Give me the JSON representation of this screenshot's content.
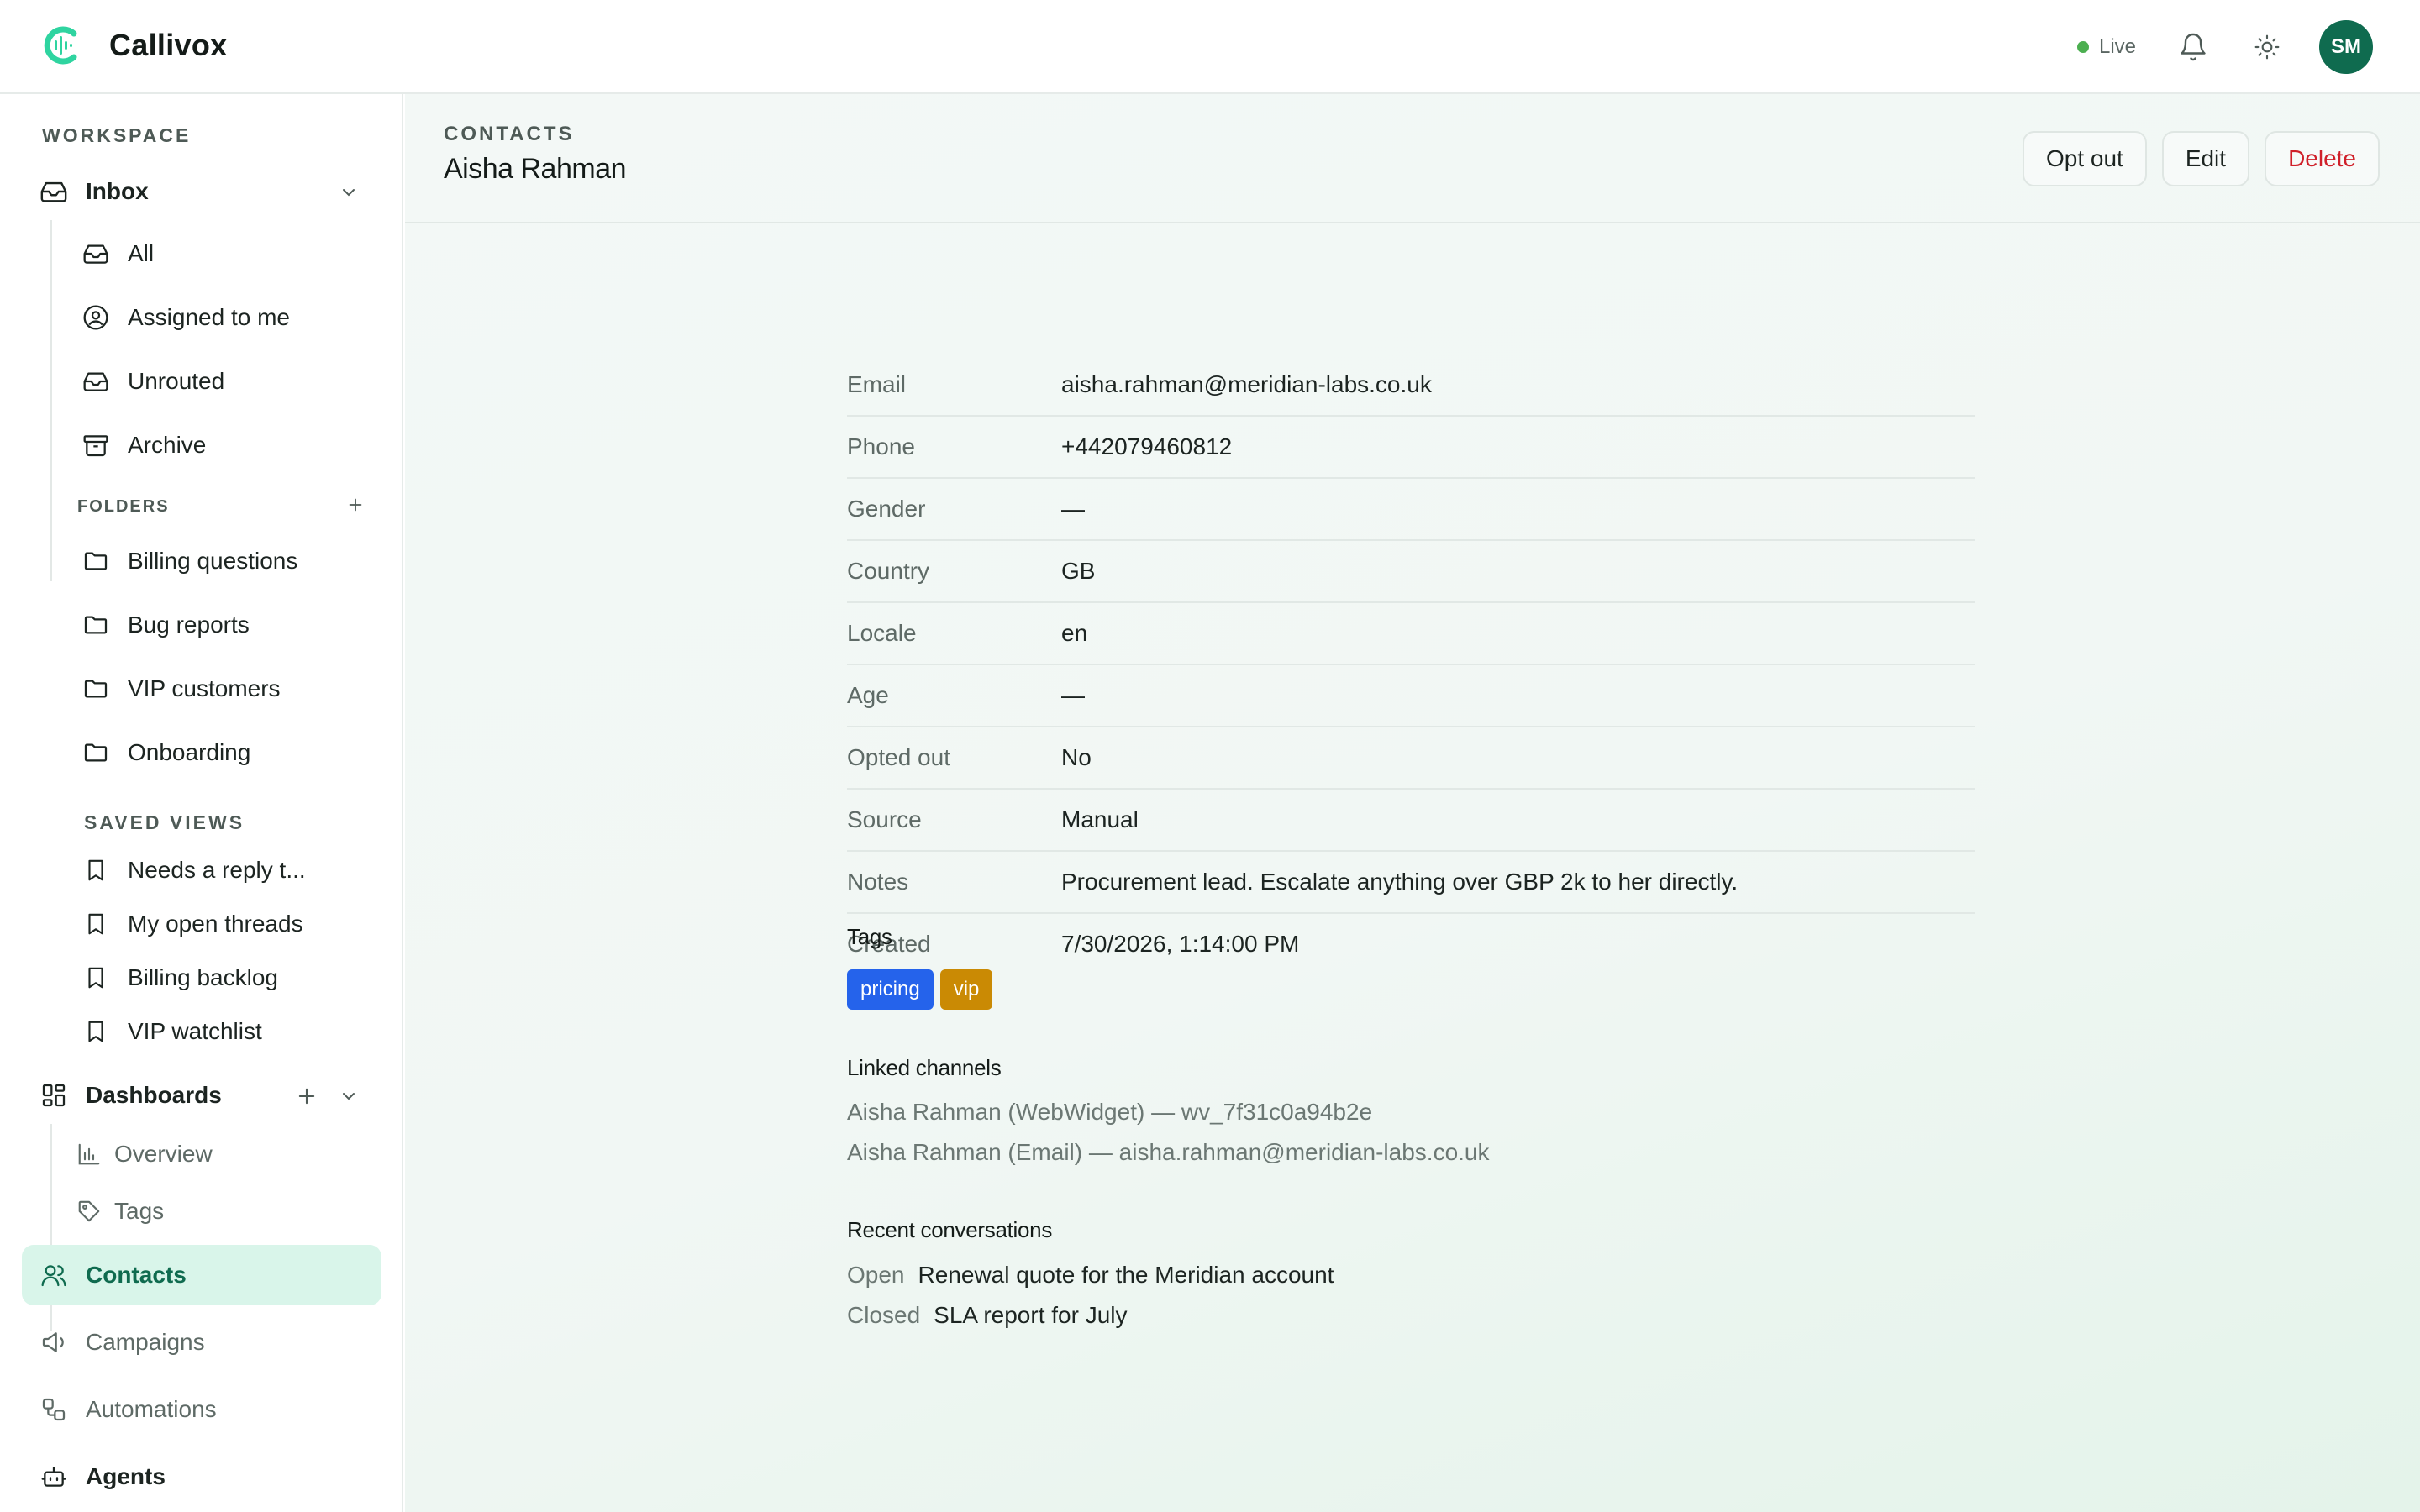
{
  "app": {
    "name": "Callivox",
    "accent": "#2fd4a0",
    "live_label": "Live",
    "live_color": "#4caf50",
    "user_initials": "SM",
    "avatar_color": "#0f6b4f"
  },
  "sidebar": {
    "workspace_label": "WORKSPACE",
    "inbox": {
      "label": "Inbox",
      "icon": "inbox-icon",
      "items": [
        {
          "label": "All",
          "icon": "inbox-icon"
        },
        {
          "label": "Assigned to me",
          "icon": "user-circle-icon"
        },
        {
          "label": "Unrouted",
          "icon": "inbox-icon"
        },
        {
          "label": "Archive",
          "icon": "archive-icon"
        }
      ]
    },
    "folders_label": "FOLDERS",
    "folders": [
      {
        "label": "Billing questions",
        "icon": "folder-icon"
      },
      {
        "label": "Bug reports",
        "icon": "folder-icon"
      },
      {
        "label": "VIP customers",
        "icon": "folder-icon"
      },
      {
        "label": "Onboarding",
        "icon": "folder-icon"
      }
    ],
    "saved_views_label": "SAVED VIEWS",
    "saved_views": [
      {
        "label": "Needs a reply t...",
        "icon": "bookmark-icon"
      },
      {
        "label": "My open threads",
        "icon": "bookmark-icon"
      },
      {
        "label": "Billing backlog",
        "icon": "bookmark-icon"
      },
      {
        "label": "VIP watchlist",
        "icon": "bookmark-icon"
      }
    ],
    "dashboards": {
      "label": "Dashboards",
      "icon": "dashboard-icon",
      "items": [
        {
          "label": "Overview",
          "icon": "bar-chart-icon"
        },
        {
          "label": "Tags",
          "icon": "tag-icon"
        }
      ]
    },
    "bottom_items": [
      {
        "label": "Contacts",
        "icon": "users-icon",
        "active": true
      },
      {
        "label": "Campaigns",
        "icon": "megaphone-icon"
      },
      {
        "label": "Automations",
        "icon": "workflow-icon"
      },
      {
        "label": "Agents",
        "icon": "bot-icon"
      }
    ],
    "active_bg": "#d9f5ea",
    "active_color": "#0f6b4f"
  },
  "header": {
    "eyebrow": "CONTACTS",
    "title": "Aisha Rahman",
    "actions": [
      {
        "label": "Opt out"
      },
      {
        "label": "Edit"
      },
      {
        "label": "Delete",
        "color": "#d0202a"
      }
    ]
  },
  "details": [
    {
      "key": "Email",
      "value": "aisha.rahman@meridian-labs.co.uk"
    },
    {
      "key": "Phone",
      "value": "+442079460812"
    },
    {
      "key": "Gender",
      "value": "—"
    },
    {
      "key": "Country",
      "value": "GB"
    },
    {
      "key": "Locale",
      "value": "en"
    },
    {
      "key": "Age",
      "value": "—"
    },
    {
      "key": "Opted out",
      "value": "No"
    },
    {
      "key": "Source",
      "value": "Manual"
    },
    {
      "key": "Notes",
      "value": "Procurement lead. Escalate anything over GBP 2k to her directly."
    },
    {
      "key": "Created",
      "value": "7/30/2026, 1:14:00 PM"
    }
  ],
  "tags_heading": "Tags",
  "tags": [
    {
      "label": "pricing",
      "color": "#2563eb"
    },
    {
      "label": "vip",
      "color": "#ca8a04"
    }
  ],
  "linked_heading": "Linked channels",
  "linked_channels": [
    "Aisha Rahman (WebWidget) — wv_7f31c0a94b2e",
    "Aisha Rahman (Email) — aisha.rahman@meridian-labs.co.uk"
  ],
  "recent_heading": "Recent conversations",
  "recent_conversations": [
    {
      "status": "Open",
      "subject": "Renewal quote for the Meridian account"
    },
    {
      "status": "Closed",
      "subject": "SLA report for July"
    }
  ]
}
